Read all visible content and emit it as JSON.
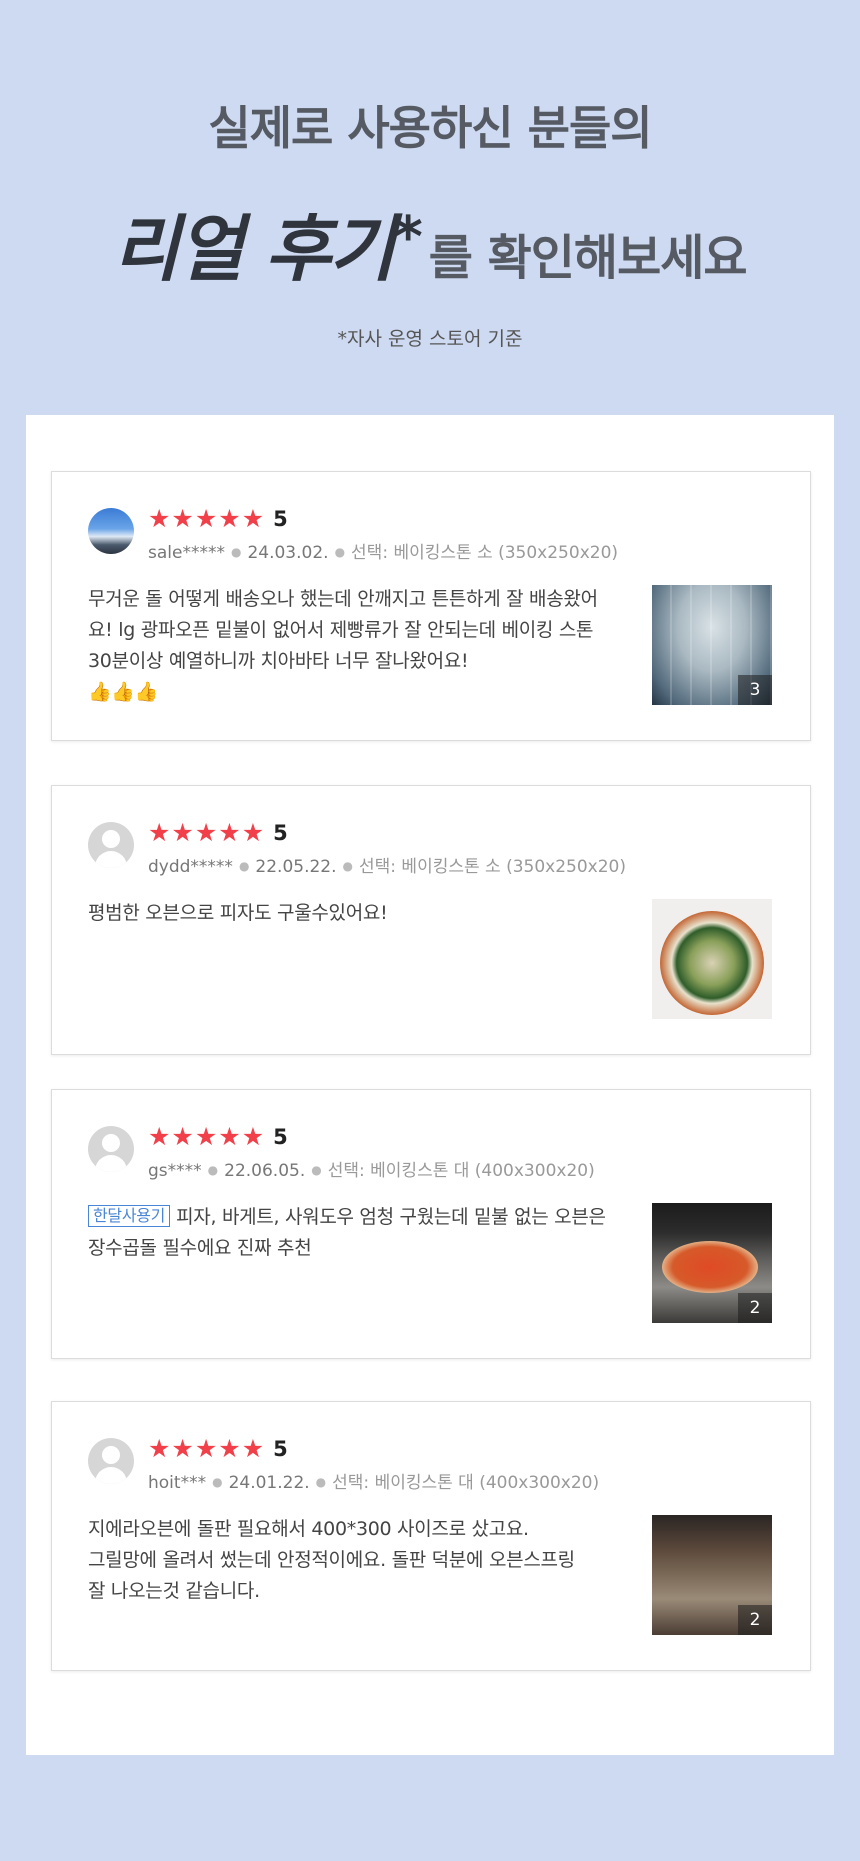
{
  "hero": {
    "line1": "실제로 사용하신 분들의",
    "line2_emphasis": "리얼 후기",
    "line2_star": "*",
    "line2_rest": "를 확인해보세요",
    "note": "*자사 운영 스토어 기준"
  },
  "reviews": [
    {
      "score": "5",
      "user": "sale*****",
      "date": "24.03.02.",
      "option": "선택: 베이킹스톤 소 (350x250x20)",
      "text": "무거운 돌 어떻게 배송오나 했는데 안깨지고 튼튼하게 잘 배송왔어요! lg 광파오픈 밑불이 없어서 제빵류가 잘 안되는데 베이킹 스톤 30분이상 예열하니까 치아바타 너무 잘나왔어요!",
      "emoji": "👍👍👍",
      "photo_count": "3"
    },
    {
      "score": "5",
      "user": "dydd*****",
      "date": "22.05.22.",
      "option": "선택: 베이킹스톤 소 (350x250x20)",
      "text": "평범한 오븐으로 피자도 구울수있어요!",
      "photo_count": ""
    },
    {
      "score": "5",
      "user": "gs****",
      "date": "22.06.05.",
      "option": "선택: 베이킹스톤 대 (400x300x20)",
      "tag": "한달사용기",
      "text": "피자, 바게트, 사워도우 엄청 구웠는데 밑불 없는 오븐은 장수곱돌 필수에요 진짜 추천",
      "photo_count": "2"
    },
    {
      "score": "5",
      "user": "hoit***",
      "date": "24.01.22.",
      "option": "선택: 베이킹스톤 대 (400x300x20)",
      "text_lines": [
        "지에라오븐에 돌판 필요해서 400*300 사이즈로 샀고요.",
        "그릴망에 올려서 썼는데 안정적이에요. 돌판 덕분에 오븐스프링",
        "잘 나오는것 같습니다."
      ],
      "photo_count": "2"
    }
  ],
  "star_glyph": "★",
  "colors": {
    "background": "#cddaf1",
    "star": "#f2404a",
    "tag": "#4a86d6"
  }
}
